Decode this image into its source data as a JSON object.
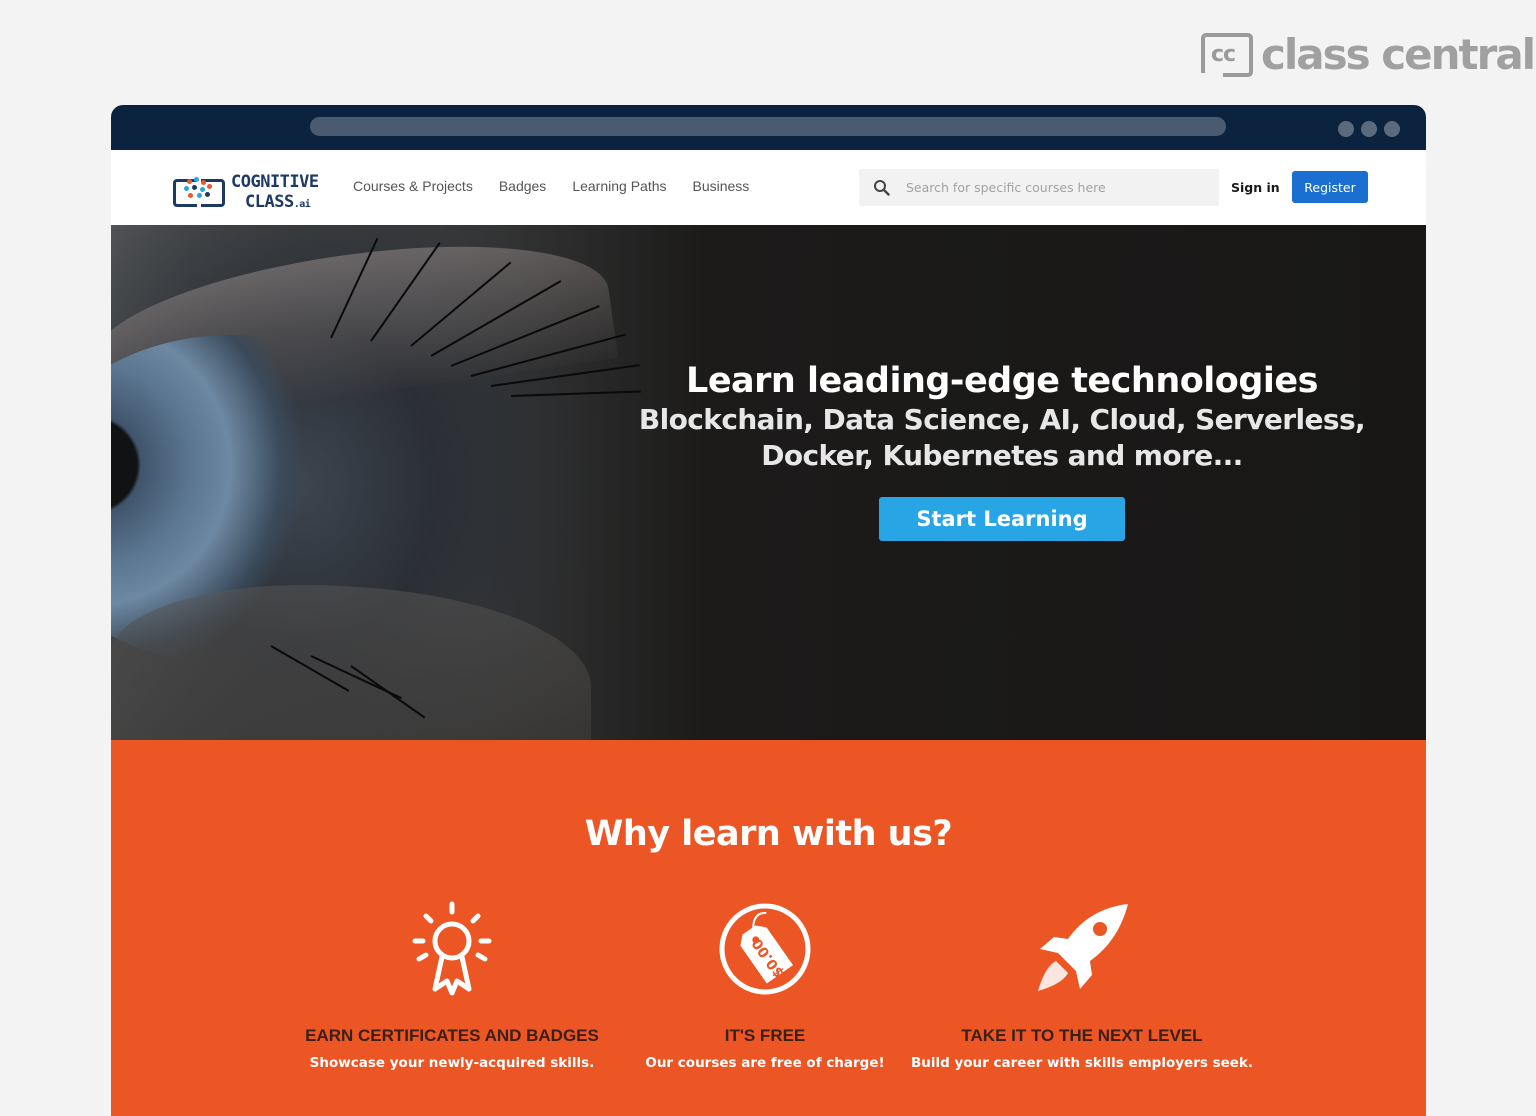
{
  "watermark": {
    "mark": "cc",
    "text": "class central"
  },
  "site": {
    "logo": {
      "line1": "COGNITIVE",
      "line2": "CLASS",
      "suffix": ".ai"
    },
    "nav": [
      "Courses & Projects",
      "Badges",
      "Learning Paths",
      "Business"
    ],
    "search_placeholder": "Search for specific courses here",
    "sign_in": "Sign in",
    "register": "Register"
  },
  "hero": {
    "title": "Learn leading-edge technologies",
    "subtitle_line1": "Blockchain, Data Science, AI, Cloud, Serverless,",
    "subtitle_line2": "Docker, Kubernetes and more...",
    "cta": "Start Learning"
  },
  "why": {
    "title": "Why learn with us?",
    "features": [
      {
        "icon": "award-icon",
        "title": "EARN CERTIFICATES AND BADGES",
        "text": "Showcase your newly-acquired skills."
      },
      {
        "icon": "price-tag-icon",
        "title": "IT'S FREE",
        "text": "Our courses are free of charge!",
        "tag_text": "$0.00"
      },
      {
        "icon": "rocket-icon",
        "title": "TAKE IT TO THE NEXT LEVEL",
        "text": "Build your career with skills employers seek."
      }
    ]
  },
  "colors": {
    "chrome": "#0c2340",
    "register": "#1b6fd1",
    "cta": "#27a5e4",
    "why_bg": "#ec5524",
    "brand": "#1e3a64"
  }
}
